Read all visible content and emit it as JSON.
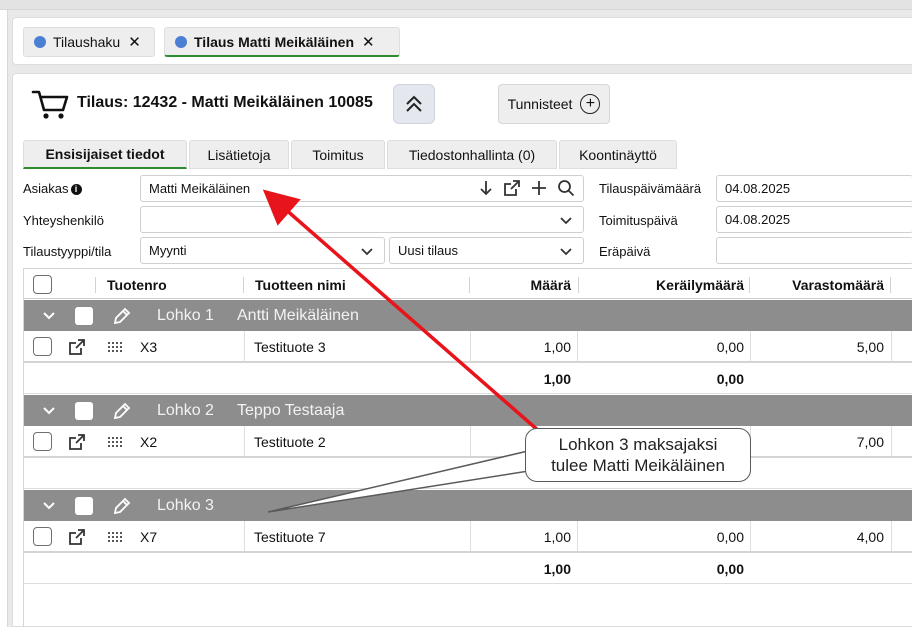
{
  "doc_tabs": [
    {
      "label": "Tilaushaku",
      "close": "✕"
    },
    {
      "label": "Tilaus Matti Meikäläinen",
      "close": "✕"
    }
  ],
  "header": {
    "title": "Tilaus: 12432 - Matti Meikäläinen 10085",
    "tags_label": "Tunnisteet"
  },
  "section_tabs": [
    "Ensisijaiset tiedot",
    "Lisätietoja",
    "Toimitus",
    "Tiedostonhallinta (0)",
    "Koontinäyttö"
  ],
  "form": {
    "customer_label": "Asiakas",
    "customer_value": "Matti Meikäläinen",
    "contact_label": "Yhteyshenkilö",
    "contact_value": "",
    "type_label": "Tilaustyyppi/tila",
    "type_value": "Myynti",
    "status_value": "Uusi tilaus",
    "order_date_label": "Tilauspäivämäärä",
    "order_date_value": "04.08.2025",
    "delivery_date_label": "Toimituspäivä",
    "delivery_date_value": "04.08.2025",
    "due_date_label": "Eräpäivä",
    "due_date_value": ""
  },
  "grid": {
    "columns": [
      "Tuotenro",
      "Tuotteen nimi",
      "Määrä",
      "Keräilymäärä",
      "Varastomäärä"
    ],
    "groups": [
      {
        "title": "Lohko 1",
        "subtitle": "Antti Meikäläinen",
        "rows": [
          {
            "product_no": "X3",
            "name": "Testituote 3",
            "qty": "1,00",
            "pick_qty": "0,00",
            "stock_qty": "5,00"
          }
        ],
        "sum_qty": "1,00",
        "sum_pick": "0,00"
      },
      {
        "title": "Lohko 2",
        "subtitle": "Teppo Testaaja",
        "rows": [
          {
            "product_no": "X2",
            "name": "Testituote 2",
            "qty": "",
            "pick_qty": "",
            "stock_qty": "7,00"
          }
        ],
        "sum_qty": "",
        "sum_pick": ""
      },
      {
        "title": "Lohko 3",
        "subtitle": "",
        "rows": [
          {
            "product_no": "X7",
            "name": "Testituote 7",
            "qty": "1,00",
            "pick_qty": "0,00",
            "stock_qty": "4,00"
          }
        ],
        "sum_qty": "1,00",
        "sum_pick": "0,00"
      }
    ]
  },
  "annotation": {
    "line1": "Lohkon 3 maksajaksi",
    "line2": "tulee Matti Meikäläinen",
    "arrow_color": "#e8141b"
  }
}
